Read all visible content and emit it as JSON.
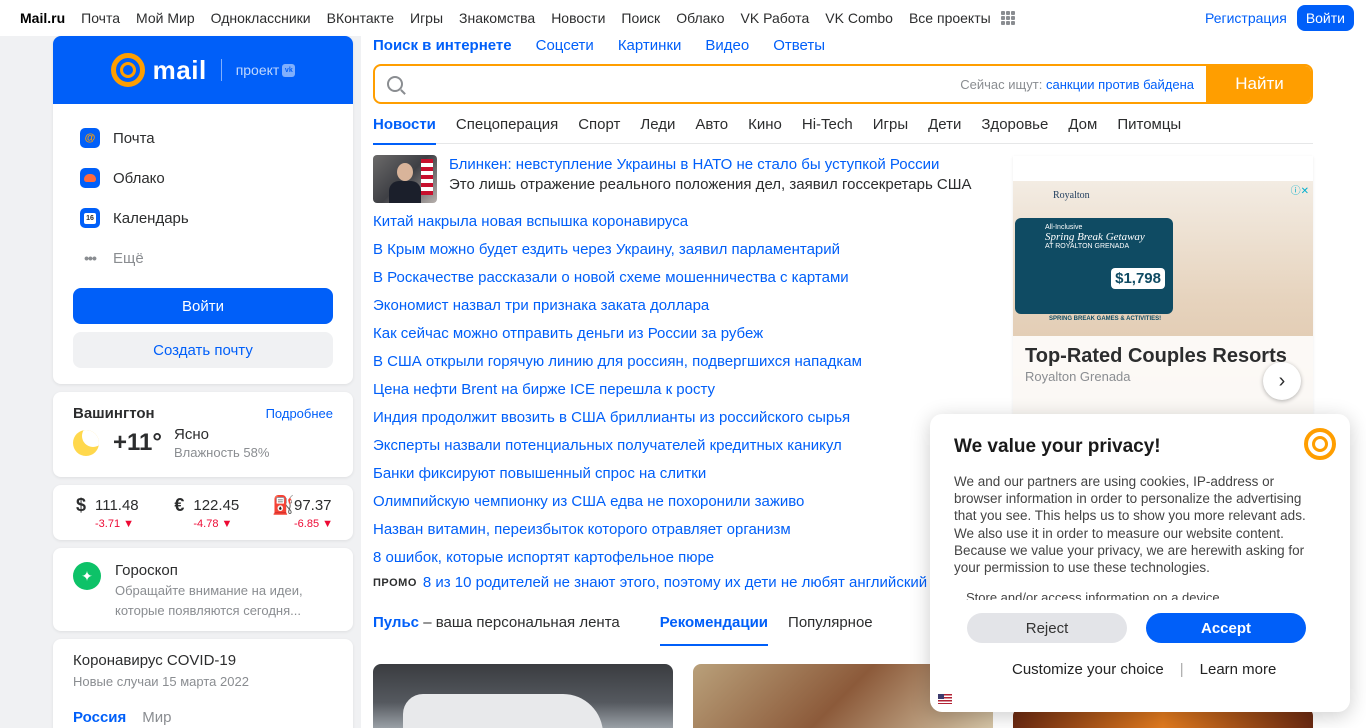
{
  "topbar": {
    "logo": "Mail.ru",
    "links": [
      "Почта",
      "Мой Мир",
      "Одноклассники",
      "ВКонтакте",
      "Игры",
      "Знакомства",
      "Новости",
      "Поиск",
      "Облако",
      "VK Работа",
      "VK Combo",
      "Все проекты"
    ],
    "register": "Регистрация",
    "login": "Войти"
  },
  "mail_card": {
    "brand": "mail",
    "project": "проект",
    "vk_badge": "vk",
    "services": [
      {
        "label": "Почта"
      },
      {
        "label": "Облако"
      },
      {
        "label": "Календарь",
        "icon_text": "16"
      },
      {
        "label": "Ещё",
        "icon_text": "•••"
      }
    ],
    "login_button": "Войти",
    "create_button": "Создать почту"
  },
  "weather": {
    "city": "Вашингтон",
    "more": "Подробнее",
    "temp": "+11°",
    "condition": "Ясно",
    "humidity": "Влажность 58%"
  },
  "rates": [
    {
      "symbol": "$",
      "value": "111.48",
      "change": "-3.71 ▼"
    },
    {
      "symbol": "€",
      "value": "122.45",
      "change": "-4.78 ▼"
    },
    {
      "symbol": "⛽",
      "value": "97.37",
      "change": "-6.85 ▼"
    }
  ],
  "horoscope": {
    "title": "Гороскоп",
    "text": "Обращайте внимание на идеи, которые появляются сегодня..."
  },
  "covid": {
    "title": "Коронавирус COVID-19",
    "subtitle": "Новые случаи 15 марта 2022",
    "tabs": [
      "Россия",
      "Мир"
    ]
  },
  "search": {
    "tabs": [
      "Поиск в интернете",
      "Соцсети",
      "Картинки",
      "Видео",
      "Ответы"
    ],
    "placeholder": "",
    "hint_prefix": "Сейчас ищут:",
    "hint_query": "санкции против байдена",
    "button": "Найти"
  },
  "news_tabs": [
    "Новости",
    "Спецоперация",
    "Спорт",
    "Леди",
    "Авто",
    "Кино",
    "Hi-Tech",
    "Игры",
    "Дети",
    "Здоровье",
    "Дом",
    "Питомцы"
  ],
  "lead_news": {
    "title": "Блинкен: невступление Украины в НАТО не стало бы уступкой России",
    "subtitle": "Это лишь отражение реального положения дел, заявил госсекретарь США"
  },
  "news": [
    "Китай накрыла новая вспышка коронавируса",
    "В Крым можно будет ездить через Украину, заявил парламентарий",
    "В Роскачестве рассказали о новой схеме мошенничества с картами",
    "Экономист назвал три признака заката доллара",
    "Как сейчас можно отправить деньги из России за рубеж",
    "В США открыли горячую линию для россиян, подвергшихся нападкам",
    "Цена нефти Brent на бирже ICE перешла к росту",
    "Индия продолжит ввозить в США бриллианты из российского сырья",
    "Эксперты назвали потенциальных получателей кредитных каникул",
    "Банки фиксируют повышенный спрос на слитки",
    "Олимпийскую чемпионку из США едва не похоронили заживо",
    "Назван витамин, переизбыток которого отравляет организм",
    "8 ошибок, которые испортят картофельное пюре"
  ],
  "promo": {
    "tag": "ПРОМО",
    "text": "8 из 10 родителей не знают этого, поэтому их дети не любят английский"
  },
  "pulse": {
    "name": "Пульс",
    "desc": "– ваша персональная лента",
    "tabs": [
      "Рекомендации",
      "Популярное"
    ]
  },
  "ad": {
    "logo": "Royalton",
    "panel_line1": "All-Inclusive",
    "panel_line2": "Spring Break Getaway",
    "panel_line3": "AT ROYALTON GRENADA",
    "price": "$1,798",
    "stripe": "SPRING BREAK GAMES & ACTIVITIES!",
    "title": "Top-Rated Couples Resorts",
    "brand": "Royalton Grenada",
    "info": "ⓘ✕"
  },
  "privacy": {
    "title": "We value your privacy!",
    "text": "We and our partners are using cookies, IP-address or browser information in order to personalize the advertising that you see. This helps us to show you more relevant ads. We also use it in order to measure our website content. Because we value your privacy, we are herewith asking for your permission to use these technologies.",
    "store": "Store and/or access information on a device",
    "reject": "Reject",
    "accept": "Accept",
    "customize": "Customize your choice",
    "sep": "|",
    "learn": "Learn more"
  },
  "colors": {
    "brand_blue": "#005ff9",
    "brand_orange": "#ff9e00",
    "negative": "#ed0a34"
  }
}
